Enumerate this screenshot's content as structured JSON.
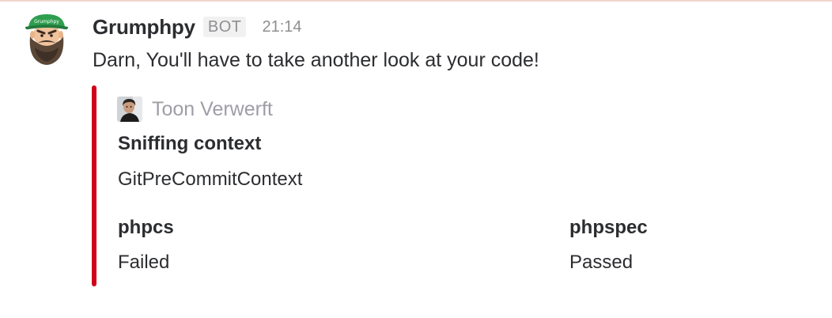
{
  "message": {
    "sender": "Grumphpy",
    "badge": "BOT",
    "time": "21:14",
    "text": "Darn, You'll have to take another look at your code!",
    "avatar_icon": "bearded-man-green-cap-avatar",
    "avatar_cap_label": "Grumphpy"
  },
  "attachment": {
    "color": "#d0021b",
    "author": {
      "name": "Toon Verwerft",
      "avatar_icon": "person-photo-avatar"
    },
    "fields": [
      {
        "title": "Sniffing context",
        "value": "GitPreCommitContext"
      },
      {
        "title": "phpcs",
        "value": "Failed"
      },
      {
        "title": "phpspec",
        "value": "Passed"
      }
    ]
  }
}
